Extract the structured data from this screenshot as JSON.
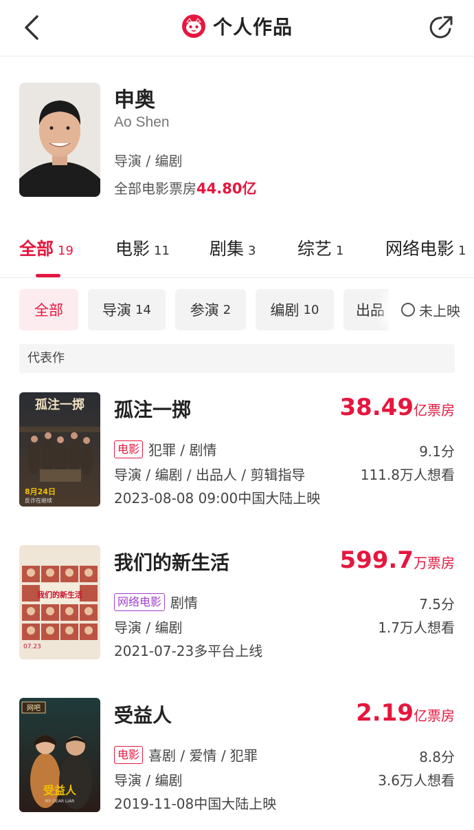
{
  "nav": {
    "title": "个人作品",
    "back_icon": "chevron-left-icon",
    "share_icon": "share-icon",
    "logo_icon": "maoyan-cat-logo"
  },
  "profile": {
    "name": "申奥",
    "en_name": "Ao Shen",
    "roles": "导演 / 编剧",
    "box_label": "全部电影票房",
    "box_value": "44.80亿"
  },
  "tabs": [
    {
      "label": "全部",
      "count": "19",
      "active": true
    },
    {
      "label": "电影",
      "count": "11"
    },
    {
      "label": "剧集",
      "count": "3"
    },
    {
      "label": "综艺",
      "count": "1"
    },
    {
      "label": "网络电影",
      "count": "1"
    }
  ],
  "filters": [
    {
      "label": "全部",
      "count": "",
      "active": true
    },
    {
      "label": "导演",
      "count": "14"
    },
    {
      "label": "参演",
      "count": "2"
    },
    {
      "label": "编剧",
      "count": "10"
    },
    {
      "label": "出品",
      "count": ""
    }
  ],
  "unreleased_label": "未上映",
  "section_label": "代表作",
  "movies": [
    {
      "title": "孤注一掷",
      "box_value": "38.49",
      "box_unit": "亿票房",
      "badge": "电影",
      "genres": "犯罪 / 剧情",
      "score": "9.1分",
      "roles": "导演 / 编剧 / 出品人 / 剪辑指导",
      "want": "111.8万人想看",
      "date": "2023-08-08 09:00中国大陆上映",
      "poster_title": "孤注一掷",
      "poster_date": "8月24日",
      "poster_sub": "反诈在继续"
    },
    {
      "title": "我们的新生活",
      "box_value": "599.7",
      "box_unit": "万票房",
      "badge": "网络电影",
      "genres": "剧情",
      "score": "7.5分",
      "roles": "导演 / 编剧",
      "want": "1.7万人想看",
      "date": "2021-07-23多平台上线",
      "poster_title": "我们的新生活",
      "poster_date": "07.23"
    },
    {
      "title": "受益人",
      "box_value": "2.19",
      "box_unit": "亿票房",
      "badge": "电影",
      "genres": "喜剧 / 爱情 / 犯罪",
      "score": "8.8分",
      "roles": "导演 / 编剧",
      "want": "3.6万人想看",
      "date": "2019-11-08中国大陆上映",
      "poster_title": "受益人",
      "poster_sub": "MY DEAR LIAR",
      "poster_sign": "网吧"
    }
  ],
  "colors": {
    "accent": "#e5173e",
    "web_badge": "#a03ecf",
    "chip_bg": "#f3f3f3",
    "chip_active_bg": "#fdecef"
  }
}
